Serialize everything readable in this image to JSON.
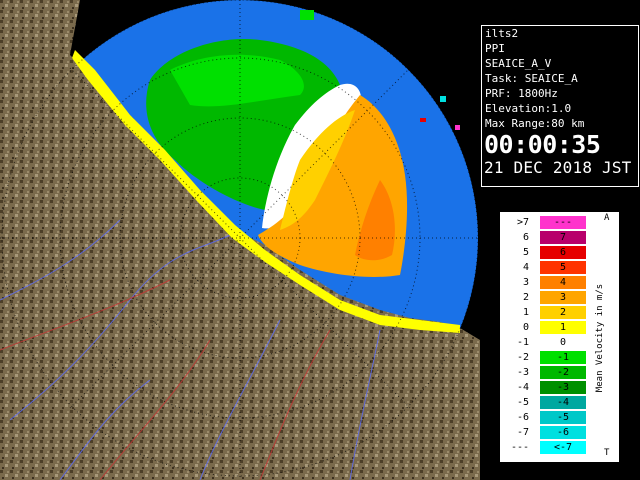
{
  "radar": {
    "site": "ilts2",
    "mode": "PPI",
    "product": "SEAICE_A_V",
    "task": "Task: SEAICE_A",
    "prf": "PRF: 1800Hz",
    "elevation": "Elevation:1.0",
    "max_range": "Max Range:80 km",
    "time": "00:00:35",
    "date": "21 DEC 2018 JST"
  },
  "legend": {
    "title": "Mean Velocity in m/s",
    "top_end": "A",
    "bottom_end": "T",
    "rows": [
      {
        "label": ">7",
        "value": "---",
        "color": "#ff33cc"
      },
      {
        "label": "6",
        "value": "7",
        "color": "#b8006b"
      },
      {
        "label": "5",
        "value": "6",
        "color": "#e60000"
      },
      {
        "label": "4",
        "value": "5",
        "color": "#ff3300"
      },
      {
        "label": "3",
        "value": "4",
        "color": "#ff8000"
      },
      {
        "label": "2",
        "value": "3",
        "color": "#ffa500"
      },
      {
        "label": "1",
        "value": "2",
        "color": "#ffd000"
      },
      {
        "label": "0",
        "value": "1",
        "color": "#ffff00"
      },
      {
        "label": "-1",
        "value": "0",
        "color": "#ffffff"
      },
      {
        "label": "-2",
        "value": "-1",
        "color": "#00e000"
      },
      {
        "label": "-3",
        "value": "-2",
        "color": "#00b800"
      },
      {
        "label": "-4",
        "value": "-3",
        "color": "#009000"
      },
      {
        "label": "-5",
        "value": "-4",
        "color": "#00a8a0"
      },
      {
        "label": "-6",
        "value": "-5",
        "color": "#00c8c8"
      },
      {
        "label": "-7",
        "value": "-6",
        "color": "#00e0e0"
      },
      {
        "label": "---",
        "value": "<-7",
        "color": "#00ffff"
      }
    ]
  }
}
